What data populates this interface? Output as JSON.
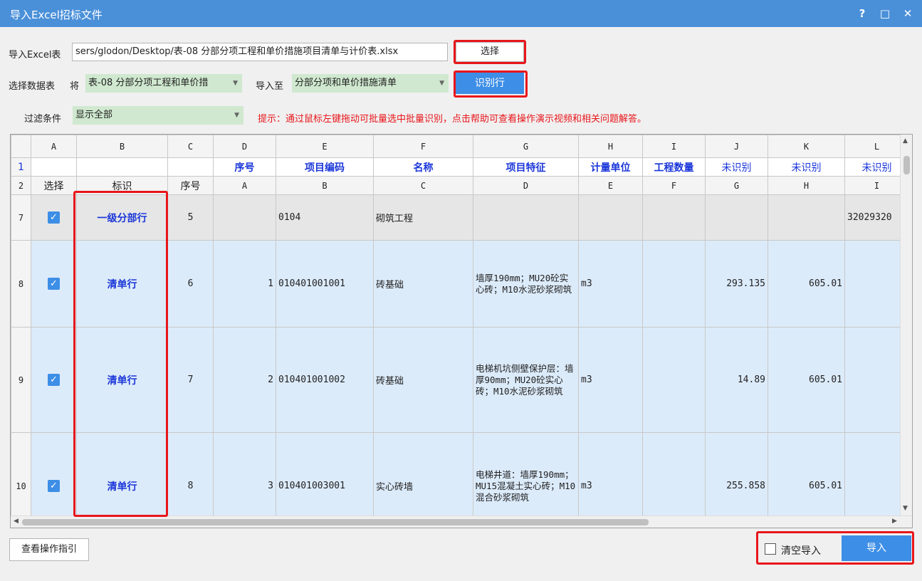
{
  "window": {
    "title": "导入Excel招标文件",
    "help": "?",
    "maximize": "□",
    "close": "✕"
  },
  "import_row": {
    "label": "导入Excel表",
    "path": "sers/glodon/Desktop/表-08 分部分项工程和单价措施项目清单与计价表.xlsx",
    "select_button": "选择"
  },
  "datasheet_row": {
    "label": "选择数据表",
    "jiang": "将",
    "sheet": "表-08 分部分项工程和单价措",
    "import_to_label": "导入至",
    "import_to": "分部分项和单价措施清单",
    "identify_button": "识别行"
  },
  "filter_row": {
    "label": "过滤条件",
    "value": "显示全部",
    "hint": "提示：通过鼠标左键拖动可批量选中批量识别，点击帮助可查看操作演示视频和相关问题解答。"
  },
  "grid": {
    "columns": [
      "A",
      "B",
      "C",
      "D",
      "E",
      "F",
      "G",
      "H",
      "I",
      "J",
      "K",
      "L"
    ],
    "row1": {
      "num": "1",
      "cells": [
        "",
        "",
        "",
        "序号",
        "项目编码",
        "名称",
        "项目特征",
        "计量单位",
        "工程数量",
        "未识别",
        "未识别",
        "未识别"
      ]
    },
    "row2": {
      "num": "2",
      "cells": [
        "选择",
        "标识",
        "序号",
        "A",
        "B",
        "C",
        "D",
        "E",
        "F",
        "G",
        "H",
        "I"
      ]
    },
    "rows": [
      {
        "num": "7",
        "checked": true,
        "tag": "一级分部行",
        "seq": "5",
        "d": "",
        "code": "0104",
        "name": "砌筑工程",
        "feature": "",
        "unit": "",
        "qty": "",
        "j": "",
        "k": "",
        "l": "32029320"
      },
      {
        "num": "8",
        "checked": true,
        "tag": "清单行",
        "seq": "6",
        "d": "1",
        "code": "010401001001",
        "name": "砖基础",
        "feature": "墙厚190mm；MU20砼实心砖；M10水泥砂浆砌筑",
        "unit": "m3",
        "qty": "",
        "j": "293.135",
        "k": "605.01",
        "l": ""
      },
      {
        "num": "9",
        "checked": true,
        "tag": "清单行",
        "seq": "7",
        "d": "2",
        "code": "010401001002",
        "name": "砖基础",
        "feature": "电梯机坑侧壁保护层：墙厚90mm；MU20砼实心砖；M10水泥砂浆砌筑",
        "unit": "m3",
        "qty": "",
        "j": "14.89",
        "k": "605.01",
        "l": ""
      },
      {
        "num": "10",
        "checked": true,
        "tag": "清单行",
        "seq": "8",
        "d": "3",
        "code": "010401003001",
        "name": "实心砖墙",
        "feature": "电梯井道：墙厚190mm；MU15混凝土实心砖；M10混合砂浆砌筑",
        "unit": "m3",
        "qty": "",
        "j": "255.858",
        "k": "605.01",
        "l": ""
      }
    ]
  },
  "footer": {
    "guide_button": "查看操作指引",
    "clear_label": "清空导入",
    "import_button": "导入"
  }
}
